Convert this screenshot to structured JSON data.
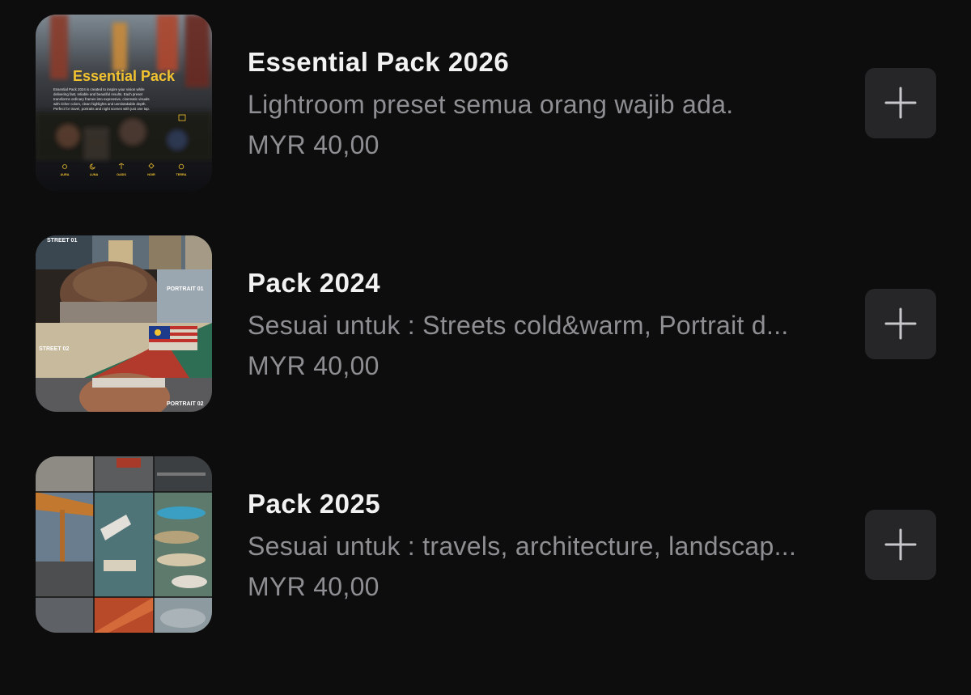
{
  "products": [
    {
      "title": "Essential Pack 2026",
      "description": "Lightroom preset semua orang wajib ada.",
      "price": "MYR 40,00",
      "thumbnail": {
        "heading": "Essential Pack",
        "blurb_lines": [
          "Essential Pack 2024 is created to inspire your vision while",
          "delivering fast, reliable and beautiful results. Each preset",
          "transforms ordinary frames into expressive, cinematic visuals",
          "with richer colors, clean highlights and unmistakable depth.",
          "Perfect for travel, portraits and night scenes with just one tap."
        ],
        "presets": [
          "AURA",
          "LUNA",
          "OASIS",
          "NOIR",
          "TERRA"
        ],
        "accent": "#f2c230"
      }
    },
    {
      "title": "Pack 2024",
      "description": "Sesuai untuk : Streets cold&warm, Portrait d...",
      "price": "MYR 40,00",
      "thumbnail": {
        "labels": [
          "STREET 01",
          "PORTRAIT 01",
          "STREET 02",
          "PORTRAIT 02"
        ]
      }
    },
    {
      "title": "Pack 2025",
      "description": "Sesuai untuk : travels, architecture, landscap...",
      "price": "MYR 40,00",
      "thumbnail": {}
    }
  ],
  "colors": {
    "background": "#0d0d0d",
    "title": "#f2f2f2",
    "secondary": "#8e8e93",
    "button": "#262628",
    "plus": "#c8c8cc"
  },
  "icons": {
    "add": "plus-icon"
  }
}
